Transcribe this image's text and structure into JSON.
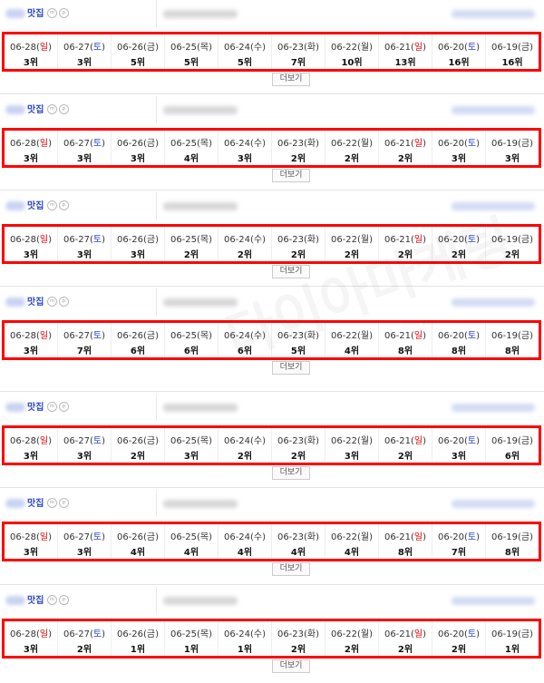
{
  "more_label": "더보기",
  "store_suffix": "맛집",
  "badge_icons": [
    "m",
    "p"
  ],
  "watermark": "다이아마케팅",
  "colors": {
    "highlight": "#ff0000",
    "sunday": "#e00000",
    "saturday": "#2a46c9"
  },
  "dates": [
    {
      "date": "06-28",
      "wd": "일"
    },
    {
      "date": "06-27",
      "wd": "토"
    },
    {
      "date": "06-26",
      "wd": "금"
    },
    {
      "date": "06-25",
      "wd": "목"
    },
    {
      "date": "06-24",
      "wd": "수"
    },
    {
      "date": "06-23",
      "wd": "화"
    },
    {
      "date": "06-22",
      "wd": "월"
    },
    {
      "date": "06-21",
      "wd": "일"
    },
    {
      "date": "06-20",
      "wd": "토"
    },
    {
      "date": "06-19",
      "wd": "금"
    }
  ],
  "blocks": [
    {
      "ranks": [
        "3위",
        "3위",
        "5위",
        "5위",
        "5위",
        "7위",
        "10위",
        "13위",
        "16위",
        "16위"
      ]
    },
    {
      "ranks": [
        "3위",
        "3위",
        "3위",
        "4위",
        "3위",
        "2위",
        "2위",
        "2위",
        "3위",
        "3위"
      ]
    },
    {
      "ranks": [
        "3위",
        "3위",
        "3위",
        "2위",
        "2위",
        "2위",
        "2위",
        "2위",
        "2위",
        "2위"
      ]
    },
    {
      "ranks": [
        "3위",
        "7위",
        "6위",
        "6위",
        "6위",
        "5위",
        "4위",
        "8위",
        "8위",
        "8위"
      ]
    },
    {
      "ranks": [
        "3위",
        "3위",
        "2위",
        "3위",
        "2위",
        "2위",
        "3위",
        "2위",
        "3위",
        "6위"
      ]
    },
    {
      "ranks": [
        "3위",
        "3위",
        "4위",
        "4위",
        "4위",
        "4위",
        "4위",
        "8위",
        "7위",
        "8위"
      ]
    },
    {
      "ranks": [
        "3위",
        "2위",
        "1위",
        "1위",
        "1위",
        "2위",
        "2위",
        "2위",
        "2위",
        "1위"
      ]
    }
  ]
}
